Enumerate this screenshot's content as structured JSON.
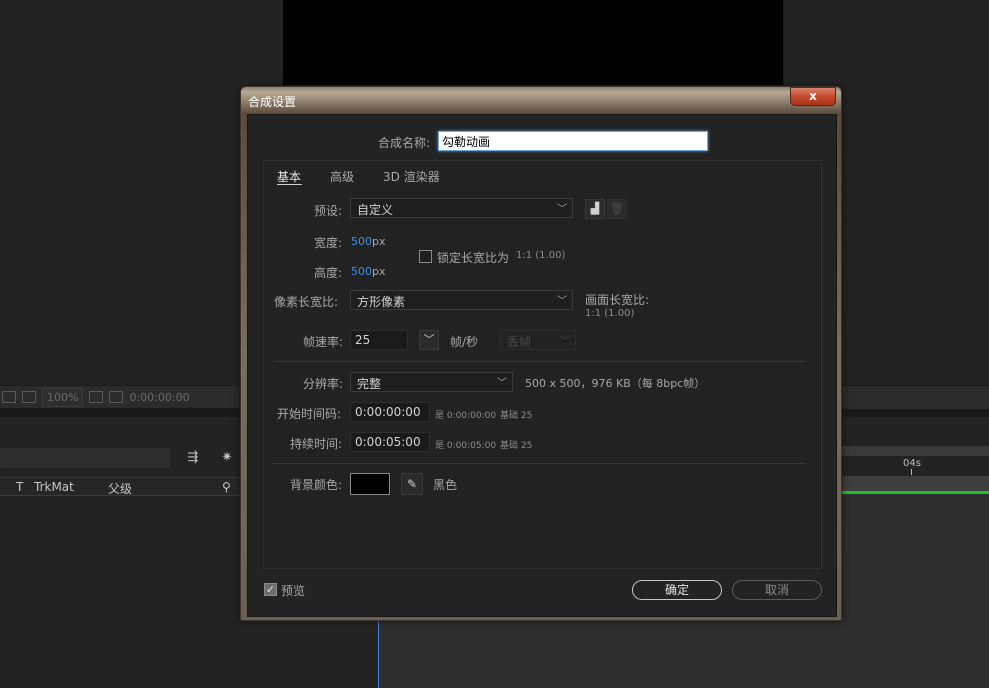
{
  "background": {
    "zoom_level": "100%",
    "timecode": "0:00:00:00",
    "columns": {
      "t": "T",
      "trkmat": "TrkMat",
      "parent": "父级"
    },
    "ruler_label": "04s"
  },
  "dialog": {
    "title": "合成设置",
    "close_label": "x",
    "name_label": "合成名称:",
    "name_value": "勾勒动画",
    "tabs": [
      {
        "label": "基本"
      },
      {
        "label": "高级"
      },
      {
        "label": "3D 渲染器"
      }
    ],
    "preset": {
      "label": "预设:",
      "value": "自定义"
    },
    "width": {
      "label": "宽度:",
      "value": "500",
      "unit": "px"
    },
    "height": {
      "label": "高度:",
      "value": "500",
      "unit": "px"
    },
    "lock_ratio": {
      "label": "锁定长宽比为",
      "ratio": "1:1 (1.00)",
      "checked": false
    },
    "pixel_aspect": {
      "label": "像素长宽比:",
      "value": "方形像素"
    },
    "frame_aspect": {
      "label": "画面长宽比:",
      "value": "1:1 (1.00)"
    },
    "frame_rate": {
      "label": "帧速率:",
      "value": "25",
      "unit": "帧/秒",
      "drop_frame": "丢帧"
    },
    "resolution": {
      "label": "分辨率:",
      "value": "完整",
      "info": "500 x 500，976 KB（每 8bpc帧）"
    },
    "start_timecode": {
      "label": "开始时间码:",
      "value": "0:00:00:00",
      "is": "是 0:00:00:00",
      "base": "基础 25"
    },
    "duration": {
      "label": "持续时间:",
      "value": "0:00:05:00",
      "is": "是 0:00:05:00",
      "base": "基础 25"
    },
    "bg_color": {
      "label": "背景颜色:",
      "name": "黑色",
      "color": "#000000"
    },
    "preview": {
      "label": "预览",
      "checked": true
    },
    "ok_label": "确定",
    "cancel_label": "取消"
  }
}
